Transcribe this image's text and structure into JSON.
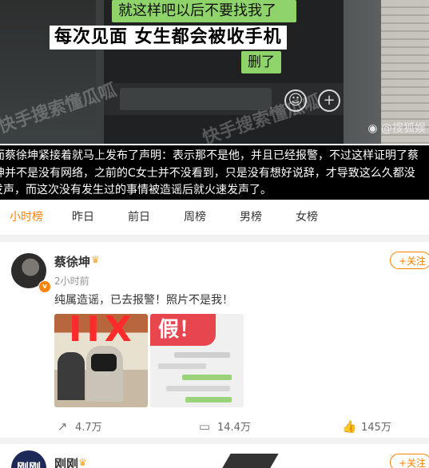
{
  "video": {
    "bubble_top": "就这样吧以后不要找我了",
    "caption": "每次见面 女生都会被收手机",
    "bubble_deleted": "删了",
    "watermark": "快手搜索懂瓜呱",
    "brand": "@搜狐娱",
    "emoji_icon": "smile-icon",
    "plus_icon": "plus-circle-icon"
  },
  "statement": {
    "line1": "而蔡徐坤紧接着就马上发布了声明：表示那不是他，并且已经报警，不过这样证明了蔡",
    "line2": "坤并不是没有网络，之前的C女士并不没看到，只是没有想好说辞，才导致这么久都没",
    "line3": "发声，而这次没有发生过的事情被造谣后就火速发声了。"
  },
  "tabs": [
    "小时榜",
    "昨日",
    "前日",
    "周榜",
    "男榜",
    "女榜"
  ],
  "active_tab_color": "#ff8200",
  "post": {
    "username": "蔡徐坤",
    "time": "2小时前",
    "follow_label": "+关注",
    "text": "纯属造谣，已去报警！照片不是我！",
    "image1_text": "IIX",
    "image2_text": "假！",
    "repost_count": "4.7万",
    "comment_count": "14.4万",
    "like_count": "145万"
  },
  "post2": {
    "avatar_text": "刚刚",
    "username": "刚刚",
    "follow_label": "+关注"
  }
}
